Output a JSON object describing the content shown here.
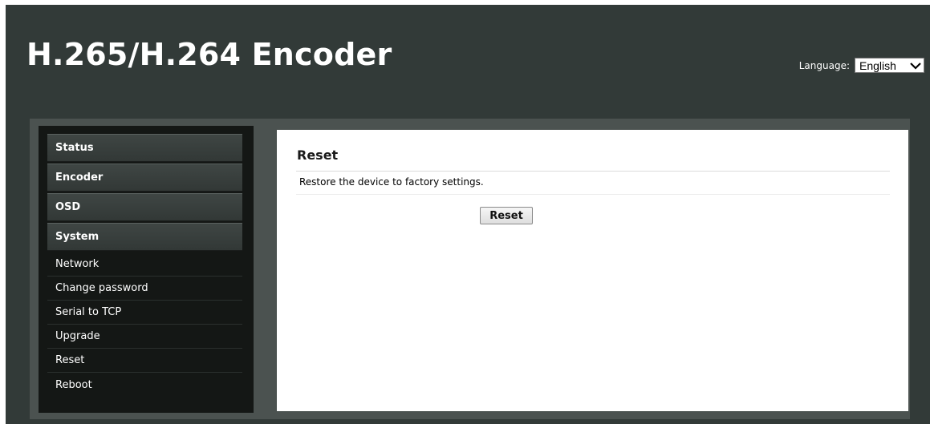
{
  "header": {
    "title": "H.265/H.264 Encoder",
    "language_label": "Language:",
    "language_selected": "English"
  },
  "sidebar": {
    "sections": [
      {
        "label": "Status"
      },
      {
        "label": "Encoder"
      },
      {
        "label": "OSD"
      },
      {
        "label": "System"
      }
    ],
    "system_items": [
      {
        "label": "Network"
      },
      {
        "label": "Change password"
      },
      {
        "label": "Serial to TCP"
      },
      {
        "label": "Upgrade"
      },
      {
        "label": "Reset"
      },
      {
        "label": "Reboot"
      }
    ]
  },
  "main": {
    "title": "Reset",
    "description": "Restore the device to factory settings.",
    "reset_button": "Reset"
  },
  "colors": {
    "header_bg": "#323a38",
    "sidebar_bg": "#141715",
    "content_bg": "#ffffff"
  }
}
